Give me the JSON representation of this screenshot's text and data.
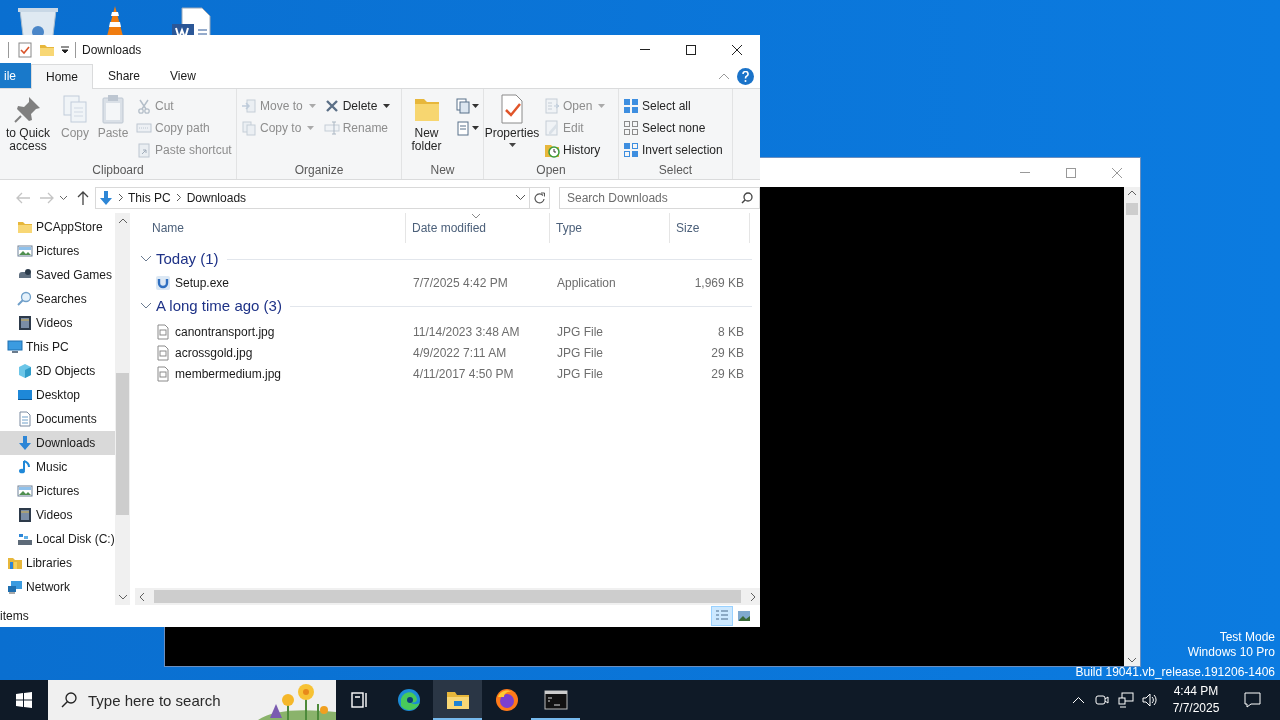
{
  "desktop_text": [
    "Test Mode",
    "Windows 10 Pro",
    "Build 19041.vb_release.191206-1406"
  ],
  "explorer": {
    "title": "Downloads",
    "tabs": [
      {
        "label": "ile",
        "kind": "file",
        "selected": false
      },
      {
        "label": "Home",
        "kind": "tab",
        "selected": true
      },
      {
        "label": "Share",
        "kind": "tab",
        "selected": false
      },
      {
        "label": "View",
        "kind": "tab",
        "selected": false
      }
    ],
    "ribbon": [
      {
        "label": "Clipboard",
        "columns": [
          [
            {
              "kind": "large",
              "label": "to Quick access",
              "disabled": false
            }
          ],
          [
            {
              "kind": "large",
              "label": "Copy",
              "disabled": true
            }
          ],
          [
            {
              "kind": "large",
              "label": "Paste",
              "disabled": true
            }
          ],
          [
            {
              "kind": "small",
              "label": "Cut",
              "disabled": true
            },
            {
              "kind": "small",
              "label": "Copy path",
              "disabled": true
            },
            {
              "kind": "small",
              "label": "Paste shortcut",
              "disabled": true
            }
          ]
        ]
      },
      {
        "label": "Organize",
        "columns": [
          [
            {
              "kind": "small",
              "label": "Move to",
              "disabled": true,
              "dropdown": true
            },
            {
              "kind": "small",
              "label": "Copy to",
              "disabled": true,
              "dropdown": true
            }
          ],
          [
            {
              "kind": "small",
              "label": "Delete",
              "disabled": false,
              "dropdown": true
            },
            {
              "kind": "small",
              "label": "Rename",
              "disabled": true
            }
          ]
        ]
      },
      {
        "label": "New",
        "columns": [
          [
            {
              "kind": "large",
              "label": "New folder",
              "disabled": false
            }
          ],
          [
            {
              "kind": "icon",
              "disabled": false,
              "dropdown": true
            },
            {
              "kind": "icon",
              "disabled": false,
              "dropdown": true
            }
          ]
        ]
      },
      {
        "label": "Open",
        "columns": [
          [
            {
              "kind": "large",
              "label": "Properties",
              "disabled": false,
              "dropdown": true
            }
          ],
          [
            {
              "kind": "small",
              "label": "Open",
              "disabled": true,
              "dropdown": true
            },
            {
              "kind": "small",
              "label": "Edit",
              "disabled": true
            },
            {
              "kind": "small",
              "label": "History",
              "disabled": false
            }
          ]
        ]
      },
      {
        "label": "Select",
        "columns": [
          [
            {
              "kind": "small",
              "label": "Select all",
              "disabled": false
            },
            {
              "kind": "small",
              "label": "Select none",
              "disabled": false
            },
            {
              "kind": "small",
              "label": "Invert selection",
              "disabled": false
            }
          ]
        ]
      }
    ],
    "address": {
      "crumbs": [
        "This PC",
        "Downloads"
      ]
    },
    "search": {
      "placeholder": "Search Downloads"
    },
    "nav_pane": {
      "quick_access_items": [
        {
          "label": "PCAppStore",
          "selected": false
        },
        {
          "label": "Pictures",
          "selected": false
        },
        {
          "label": "Saved Games",
          "selected": false
        },
        {
          "label": "Searches",
          "selected": false
        },
        {
          "label": "Videos",
          "selected": false
        }
      ],
      "tree": [
        {
          "label": "This PC",
          "selected": false,
          "children": [
            {
              "label": "3D Objects",
              "selected": false
            },
            {
              "label": "Desktop",
              "selected": false
            },
            {
              "label": "Documents",
              "selected": false
            },
            {
              "label": "Downloads",
              "selected": true
            },
            {
              "label": "Music",
              "selected": false
            },
            {
              "label": "Pictures",
              "selected": false
            },
            {
              "label": "Videos",
              "selected": false
            },
            {
              "label": "Local Disk (C:)",
              "selected": false
            }
          ]
        },
        {
          "label": "Libraries",
          "selected": false
        },
        {
          "label": "Network",
          "selected": false
        }
      ]
    },
    "columns": [
      {
        "label": "Name",
        "sorted": false
      },
      {
        "label": "Date modified",
        "sorted": true
      },
      {
        "label": "Type",
        "sorted": false
      },
      {
        "label": "Size",
        "sorted": false
      }
    ],
    "groups": [
      {
        "label": "Today (1)",
        "expanded": true,
        "files": [
          {
            "kind": "application",
            "name": "Setup.exe",
            "date": "7/7/2025 4:42 PM",
            "type": "Application",
            "size": "1,969 KB"
          }
        ]
      },
      {
        "label": "A long time ago (3)",
        "expanded": true,
        "files": [
          {
            "kind": "image",
            "name": "canontransport.jpg",
            "date": "11/14/2023 3:48 AM",
            "type": "JPG File",
            "size": "8 KB"
          },
          {
            "kind": "image",
            "name": "acrossgold.jpg",
            "date": "4/9/2022 7:11 AM",
            "type": "JPG File",
            "size": "29 KB"
          },
          {
            "kind": "image",
            "name": "membermedium.jpg",
            "date": "4/11/2017 4:50 PM",
            "type": "JPG File",
            "size": "29 KB"
          }
        ]
      }
    ],
    "status": "items",
    "views": [
      {
        "kind": "details",
        "selected": true
      },
      {
        "kind": "tiles",
        "selected": false
      }
    ]
  },
  "taskbar": {
    "search_placeholder": "Type here to search",
    "apps": [
      {
        "kind": "edge",
        "running": false,
        "selected": false
      },
      {
        "kind": "explorer",
        "running": true,
        "selected": true
      },
      {
        "kind": "firefox",
        "running": false,
        "selected": false
      },
      {
        "kind": "terminal",
        "running": true,
        "selected": false
      }
    ],
    "time": "4:44 PM",
    "date": "7/7/2025"
  }
}
